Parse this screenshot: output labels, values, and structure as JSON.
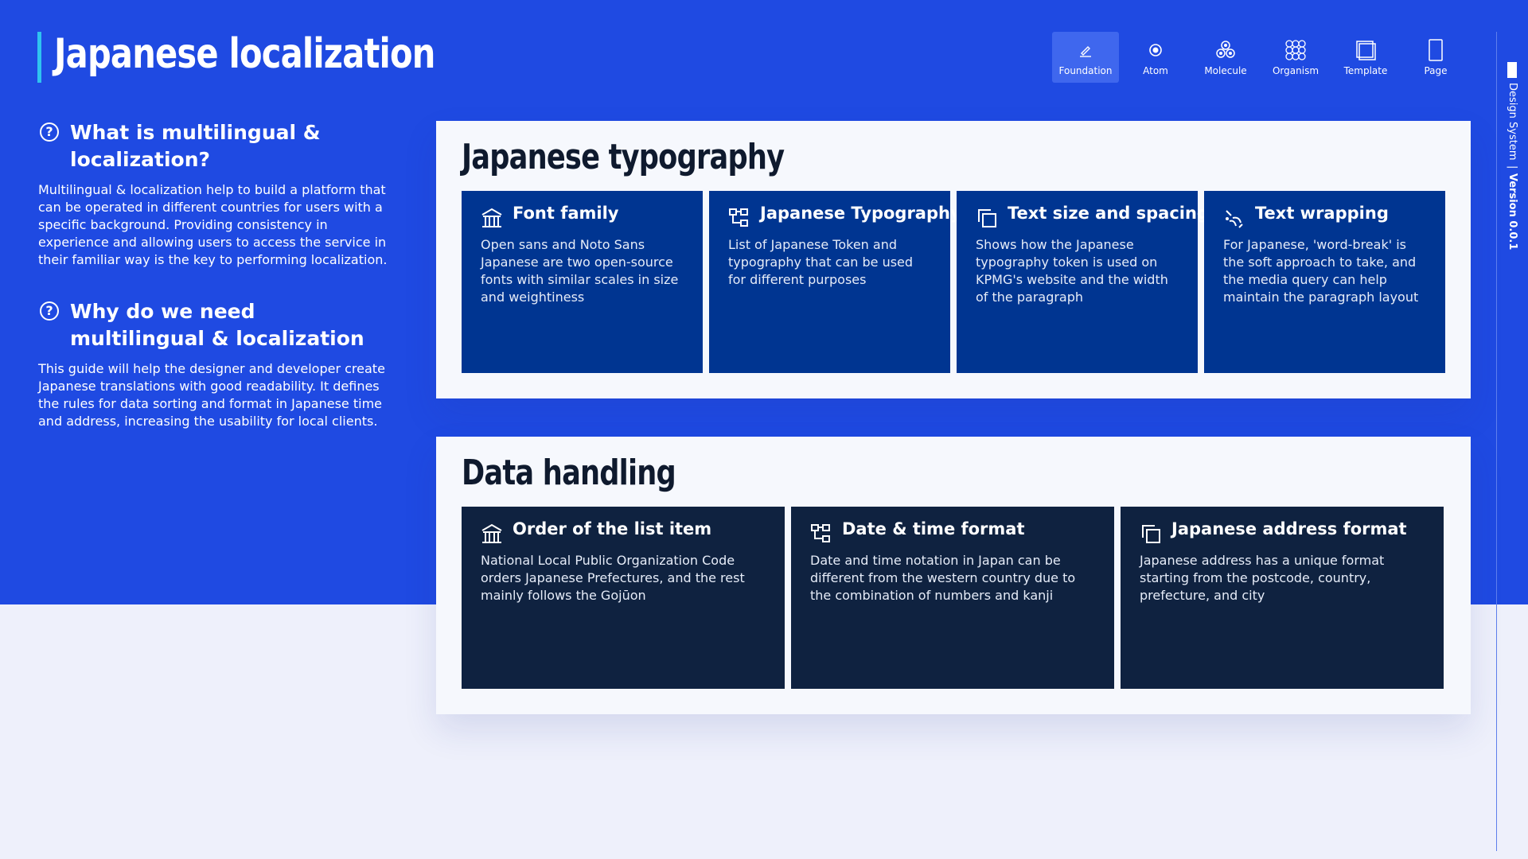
{
  "page": {
    "title": "Japanese localization"
  },
  "nav": {
    "items": [
      {
        "label": "Foundation",
        "icon": "pencil-icon",
        "active": true
      },
      {
        "label": "Atom",
        "icon": "atom-icon",
        "active": false
      },
      {
        "label": "Molecule",
        "icon": "molecule-icon",
        "active": false
      },
      {
        "label": "Organism",
        "icon": "organism-icon",
        "active": false
      },
      {
        "label": "Template",
        "icon": "template-icon",
        "active": false
      },
      {
        "label": "Page",
        "icon": "page-icon",
        "active": false
      }
    ]
  },
  "side": {
    "label": "Design System",
    "version": "Version 0.0.1"
  },
  "faq": [
    {
      "question": "What is multilingual & localization?",
      "answer": "Multilingual & localization help to build a platform that can be operated in different countries for users with a specific background. Providing consistency in experience and allowing users to access the service in their familiar way is the key to performing localization."
    },
    {
      "question": "Why do we need multilingual & localization",
      "answer": "This guide will help the designer and developer create Japanese translations with good readability. It defines the rules for data sorting and format in Japanese time and address, increasing the usability for local clients."
    }
  ],
  "sections": [
    {
      "title": "Japanese typography",
      "cards": [
        {
          "title": "Font family",
          "icon": "temple-icon",
          "desc": "Open sans and Noto Sans Japanese are two open-source fonts with similar scales in size and weightiness"
        },
        {
          "title": "Japanese Typography",
          "icon": "hierarchy-icon",
          "desc": "List of Japanese Token and typography that can be used for different purposes"
        },
        {
          "title": "Text size and spacing",
          "icon": "copy-icon",
          "desc": "Shows how the Japanese typography token is used on KPMG's website and the width of the paragraph"
        },
        {
          "title": "Text wrapping",
          "icon": "wrap-icon",
          "desc": "For Japanese, 'word-break' is the soft approach to take, and the media query can help maintain the paragraph layout"
        }
      ]
    },
    {
      "title": "Data handling",
      "cards": [
        {
          "title": "Order of the list item",
          "icon": "temple-icon",
          "desc": "National Local Public Organization Code orders Japanese Prefectures, and the rest mainly follows the Gojūon"
        },
        {
          "title": "Date & time format",
          "icon": "hierarchy-icon",
          "desc": "Date and time notation in Japan can be different from the western country due to the combination of numbers and kanji"
        },
        {
          "title": "Japanese address format",
          "icon": "copy-icon",
          "desc": "Japanese address has a unique format starting from the postcode, country, prefecture, and city"
        }
      ]
    }
  ],
  "colors": {
    "hero": "#1f4ae2",
    "accent": "#2fc3f0",
    "card_blue": "#003591",
    "card_navy": "#0f2240",
    "panel": "#f6f8fd",
    "page_bg": "#eef0fb"
  }
}
